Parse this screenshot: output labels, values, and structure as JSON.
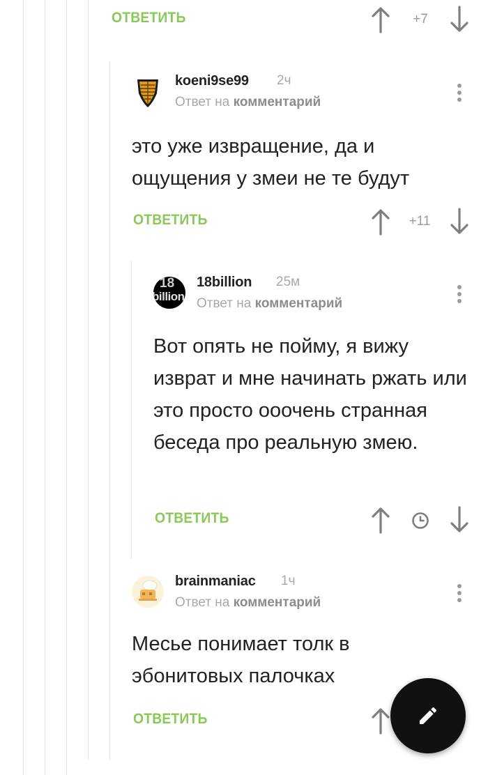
{
  "colors": {
    "reply_green": "#8ac858",
    "muted_gray": "#9a9a9a",
    "text": "#222222",
    "fab": "#111111"
  },
  "top_row": {
    "reply_label": "ОТВЕТИТЬ",
    "score": "+7"
  },
  "comments": [
    {
      "author": "koeni9se99",
      "time": "2ч",
      "answer_prefix": "Ответ на",
      "answer_link": "комментарий",
      "text": "это уже извращение, да и ощущения у змеи не те будут",
      "avatar_icon": "koenigsegg-shield-avatar",
      "reply_label": "ОТВЕТИТЬ",
      "score": "+11"
    },
    {
      "author": "18billion",
      "time": "25м",
      "answer_prefix": "Ответ на",
      "answer_link": "комментарий",
      "text": "Вот опять не пойму, я вижу изврат и мне начинать ржать или это просто ооочень странная беседа про реальную змею.",
      "avatar_icon": "18billion-avatar",
      "avatar_text_1": "18",
      "avatar_text_2": "billion",
      "reply_label": "ОТВЕТИТЬ",
      "score_icon": "clock-icon"
    },
    {
      "author": "brainmaniac",
      "time": "1ч",
      "answer_prefix": "Ответ на",
      "answer_link": "комментарий",
      "text": "Месье понимает толк в эбонитовых палочках",
      "avatar_icon": "chef-cartoon-avatar",
      "reply_label": "ОТВЕТИТЬ"
    }
  ],
  "fab": {
    "icon": "pencil-icon"
  }
}
